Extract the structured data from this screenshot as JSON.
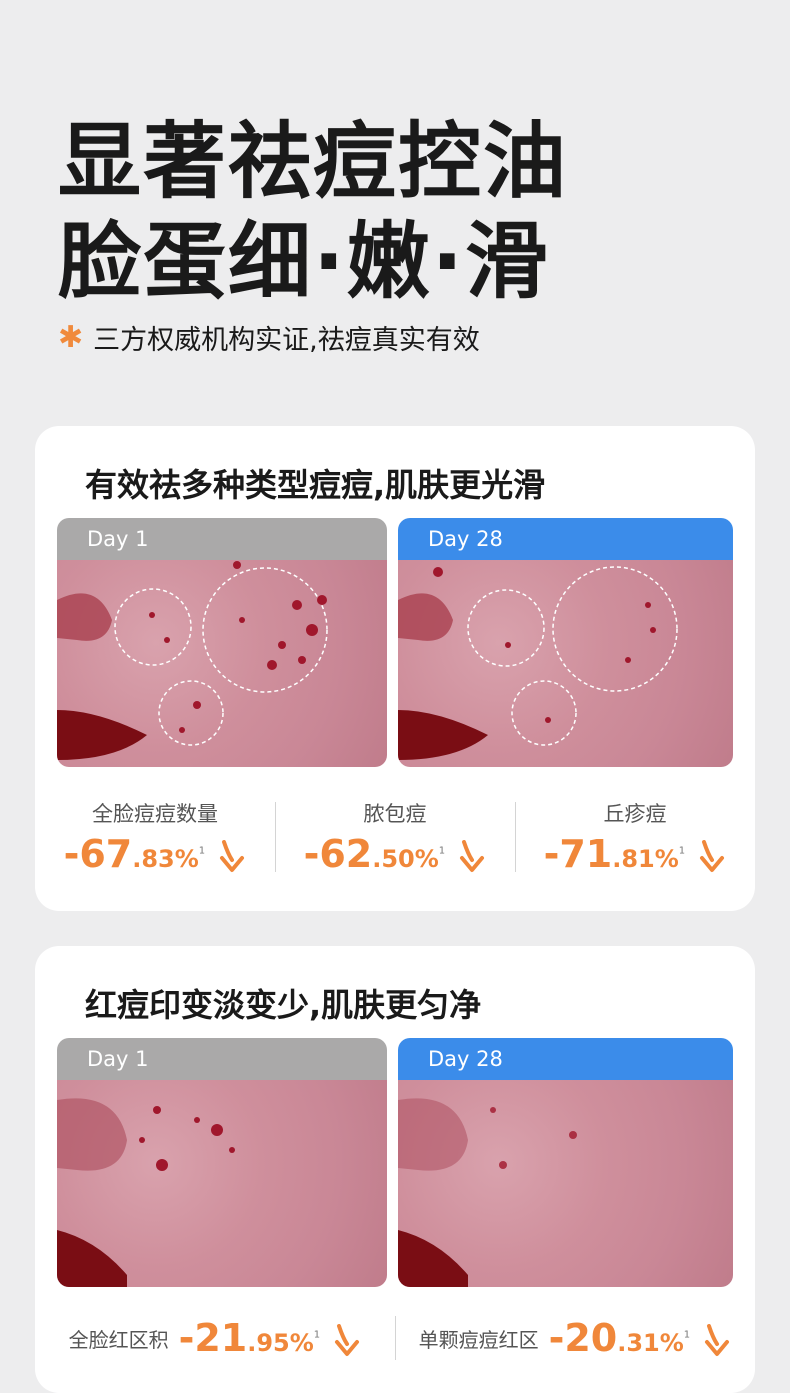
{
  "hero": {
    "title_line1": "显著祛痘控油",
    "title_line2": "脸蛋细·嫩·滑",
    "asterisk": "✱",
    "subtitle": "三方权威机构实证,祛痘真实有效"
  },
  "card1": {
    "title": "有效祛多种类型痘痘,肌肤更光滑",
    "day_before": "Day 1",
    "day_after": "Day 28",
    "stats": [
      {
        "label": "全脸痘痘数量",
        "big": "-67",
        "small": ".83%",
        "sup": "1"
      },
      {
        "label": "脓包痘",
        "big": "-62",
        "small": ".50%",
        "sup": "1"
      },
      {
        "label": "丘疹痘",
        "big": "-71",
        "small": ".81%",
        "sup": "1"
      }
    ]
  },
  "card2": {
    "title": "红痘印变淡变少,肌肤更匀净",
    "day_before": "Day 1",
    "day_after": "Day 28",
    "stats": [
      {
        "label": "全脸红区积",
        "big": "-21",
        "small": ".95%",
        "sup": "1"
      },
      {
        "label": "单颗痘痘红区",
        "big": "-20",
        "small": ".31%",
        "sup": "1"
      }
    ]
  },
  "colors": {
    "accent": "#f0873a",
    "day1": "#aaa9a9",
    "day28": "#3b8cea"
  }
}
